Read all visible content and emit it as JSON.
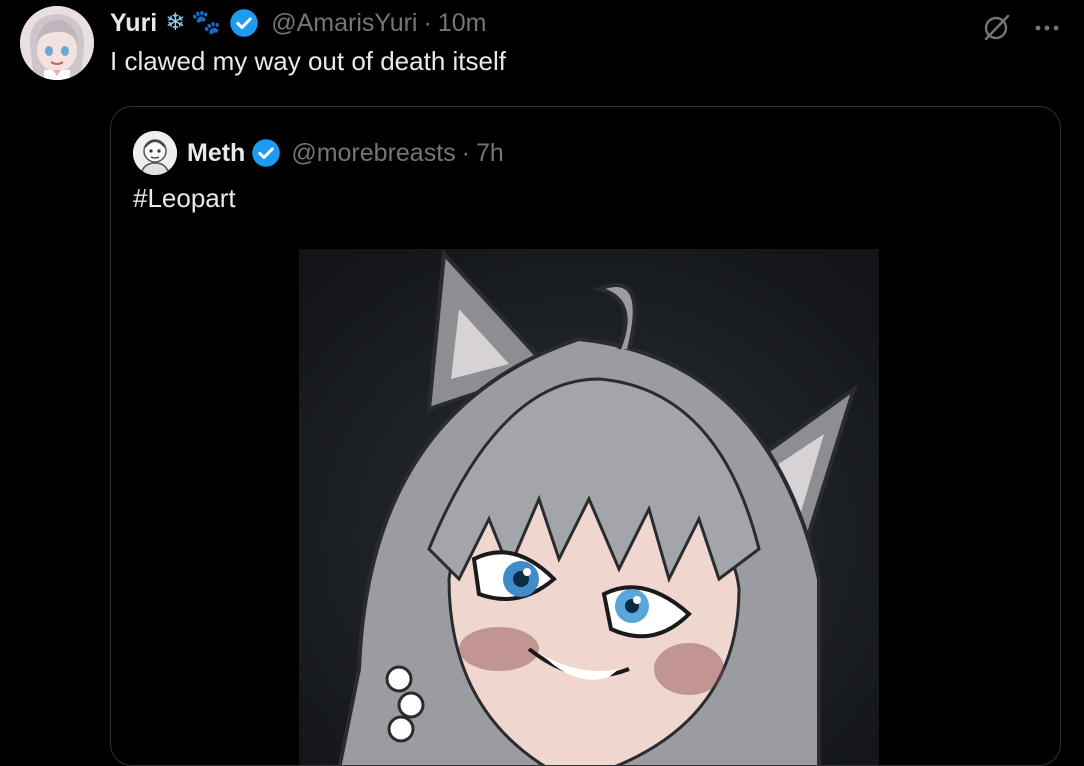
{
  "tweet": {
    "display_name": "Yuri",
    "emojis": [
      "❄",
      "🐾"
    ],
    "handle": "@AmarisYuri",
    "separator": "·",
    "time": "10m",
    "text": "I clawed my way out of death itself",
    "avatar_icon": "anime-avatar-icon",
    "verified_icon": "verified-badge-icon",
    "actions": {
      "grok_icon": "grok-icon",
      "more_icon": "more-options-icon"
    }
  },
  "quote": {
    "display_name": "Meth",
    "handle": "@morebreasts",
    "separator": "·",
    "time": "7h",
    "text": "#Leopart",
    "avatar_icon": "sketch-avatar-icon",
    "verified_icon": "verified-badge-icon",
    "media": "anime-catgirl-illustration"
  },
  "colors": {
    "background": "#000000",
    "text_primary": "#e7e9ea",
    "text_secondary": "#71767b",
    "border": "#2f3336",
    "verified_blue": "#1d9bf0"
  }
}
